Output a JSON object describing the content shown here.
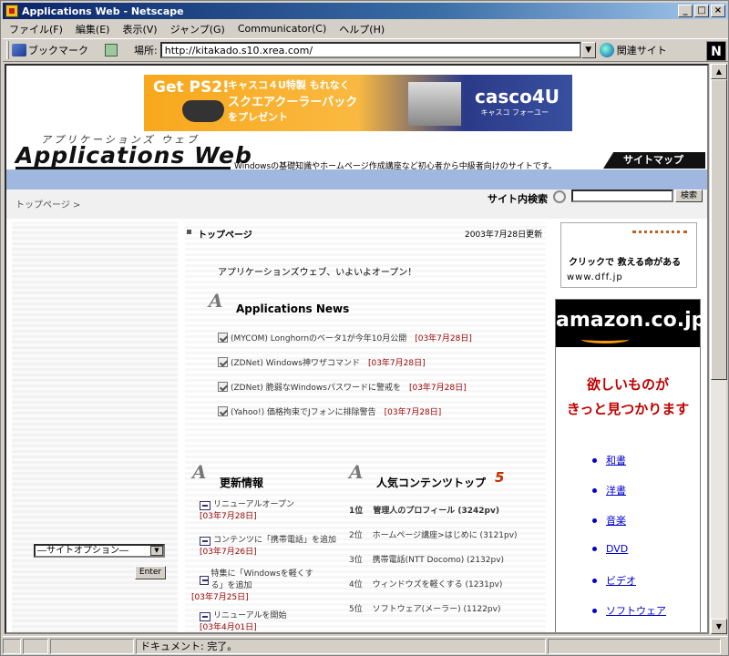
{
  "window": {
    "title": "Applications Web - Netscape"
  },
  "menubar": [
    "ファイル(F)",
    "編集(E)",
    "表示(V)",
    "ジャンプ(G)",
    "Communicator(C)",
    "ヘルプ(H)"
  ],
  "toolbar": {
    "bookmarks": "ブックマーク",
    "location_label": "場所:",
    "url": "http://kitakado.s10.xrea.com/",
    "related": "関連サイト"
  },
  "banner": {
    "text1": "Get PS2!",
    "text2": "キャスコ４U特製 もれなく",
    "text3": "スクエアクーラーバック",
    "text4": "をプレゼント",
    "brand": "casco4U",
    "brand_sub": "キャスコ フォーユー"
  },
  "header": {
    "logo_sub": "アプリケーションズ ウェブ",
    "logo": "Applications Web",
    "tagline": "Windowsの基礎知識やホームページ作成講座など初心者から中級者向けのサイトです。",
    "sitemap": "サイトマップ"
  },
  "crumb": "トップページ >",
  "search": {
    "label": "サイト内検索",
    "button": "検索"
  },
  "left": {
    "select_value": "―サイトオプション―",
    "enter": "Enter"
  },
  "main": {
    "title": "トップページ",
    "updated": "2003年7月28日更新",
    "lead": "アプリケーションズウェブ、いよいよオープン！",
    "news_heading": "Applications News",
    "news": [
      {
        "text": "(MYCOM) Longhornのベータ1が今年10月公開",
        "date": "[03年7月28日]"
      },
      {
        "text": "(ZDNet) Windows神ワザコマンド",
        "date": "[03年7月28日]"
      },
      {
        "text": "(ZDNet) 脆弱なWindowsパスワードに警戒を",
        "date": "[03年7月28日]"
      },
      {
        "text": "(Yahoo!) 価格拘束でJフォンに排除警告",
        "date": "[03年7月28日]"
      }
    ],
    "updates_heading": "更新情報",
    "updates": [
      {
        "text": "リニューアルオープン",
        "date": "[03年7月28日]"
      },
      {
        "text": "コンテンツに「携帯電話」を追加",
        "date": "[03年7月26日]"
      },
      {
        "text": "特集に「Windowsを軽くする」を追加",
        "date": "[03年7月25日]"
      },
      {
        "text": "リニューアルを開始",
        "date": "[03年4月01日]"
      }
    ],
    "popular_heading": "人気コンテンツトップ",
    "popular_five": "5",
    "popular": [
      {
        "rank": "1位",
        "text": "管理人のプロフィール (3242pv)"
      },
      {
        "rank": "2位",
        "text": "ホームページ講座>はじめに (3121pv)"
      },
      {
        "rank": "3位",
        "text": "携帯電話(NTT Docomo) (2132pv)"
      },
      {
        "rank": "4位",
        "text": "ウィンドウズを軽くする (1231pv)"
      },
      {
        "rank": "5位",
        "text": "ソフトウェア(メーラー) (1122pv)"
      }
    ]
  },
  "ads": {
    "dff_line1": "クリックで 救える命がある",
    "dff_line2": "www.dff.jp",
    "amazon_logo": "amazon.co.jp",
    "amazon_line1": "欲しいものが",
    "amazon_line2": "きっと見つかります",
    "amazon_links": [
      "和書",
      "洋書",
      "音楽",
      "DVD",
      "ビデオ",
      "ソフトウェア"
    ]
  },
  "status": {
    "text": "ドキュメント: 完了。"
  }
}
